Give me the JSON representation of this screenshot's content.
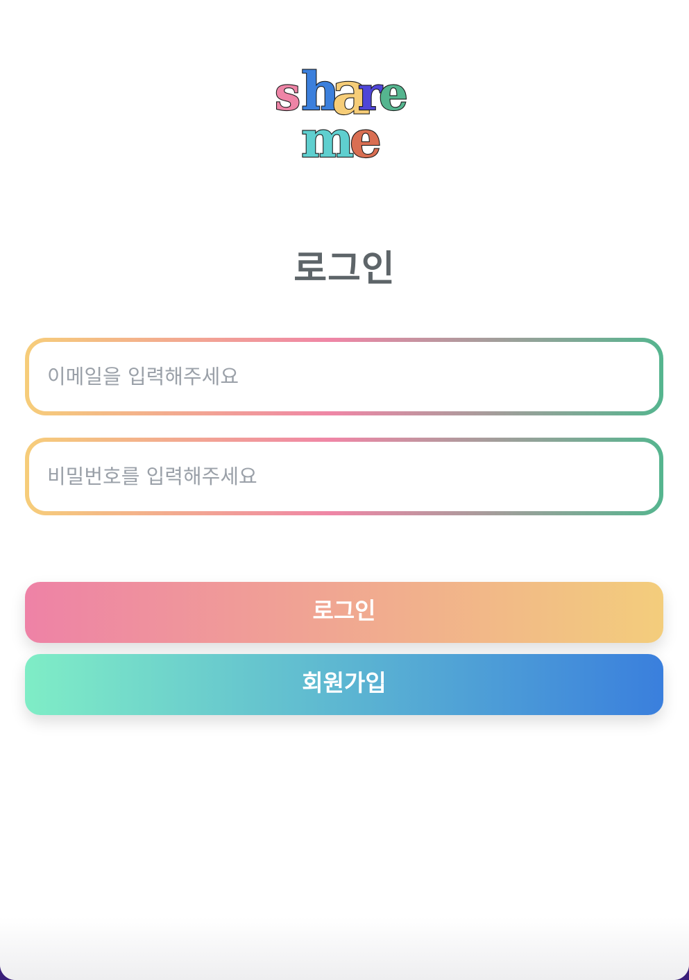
{
  "logo": {
    "word1": "share",
    "word2": "me",
    "letter_colors": {
      "s": "#ee84a6",
      "h": "#3b7fdc",
      "a": "#f6cd78",
      "r": "#4f46d8",
      "e": "#55b58f",
      "m": "#5fcfcf",
      "e2": "#d96e52"
    }
  },
  "page": {
    "title": "로그인"
  },
  "form": {
    "email_placeholder": "이메일을 입력해주세요",
    "email_value": "",
    "password_placeholder": "비밀번호를 입력해주세요",
    "password_value": ""
  },
  "buttons": {
    "login_label": "로그인",
    "signup_label": "회원가입"
  },
  "colors": {
    "field_border_gradient": [
      "#f6cd7a",
      "#ef86a6",
      "#55b58f"
    ],
    "login_gradient": [
      "#ee82a6",
      "#f3cd7c"
    ],
    "signup_gradient": [
      "#7fedc6",
      "#3a7fdd"
    ],
    "title_color": "#5e6569",
    "placeholder_color": "#9aa0a8"
  }
}
